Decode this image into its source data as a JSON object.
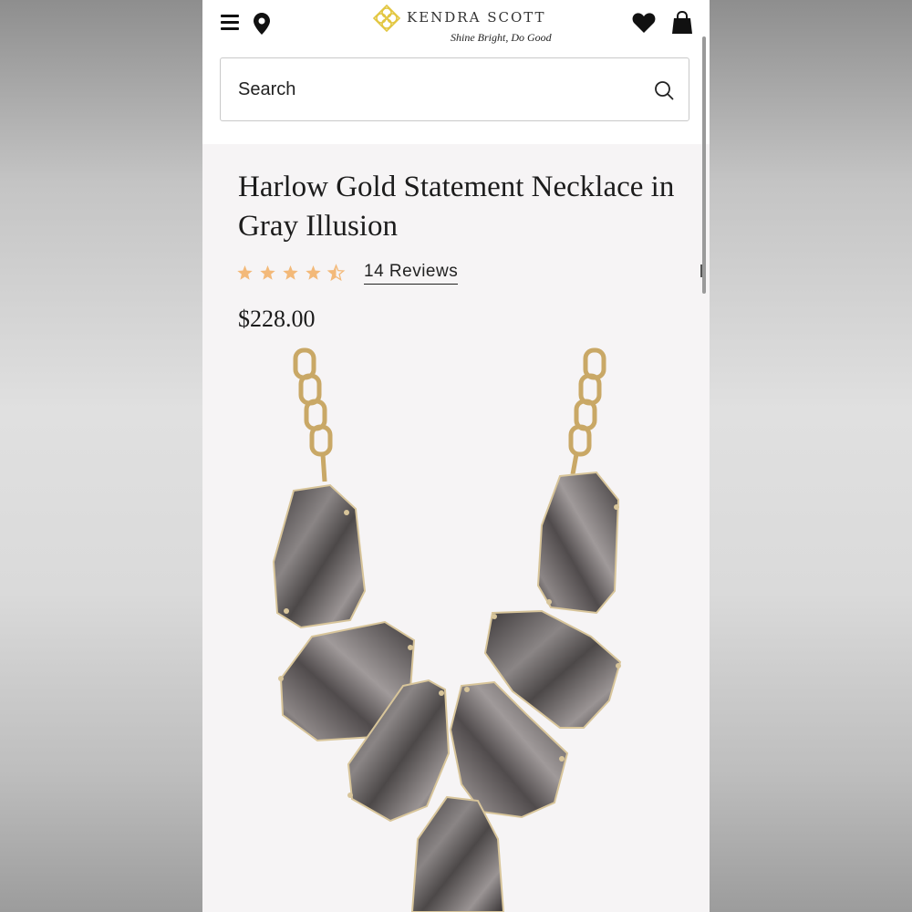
{
  "header": {
    "brand_name": "KENDRA SCOTT",
    "tagline": "Shine Bright, Do Good",
    "icons": [
      "menu-icon",
      "location-pin-icon",
      "logo-icon",
      "heart-icon",
      "shopping-bag-icon"
    ]
  },
  "search": {
    "placeholder": "Search",
    "icon": "search-icon"
  },
  "product": {
    "title": "Harlow Gold Statement Necklace in Gray Illusion",
    "rating": 4.5,
    "rating_max": 5,
    "reviews_label": "14 Reviews",
    "price": "$228.00",
    "image_alt": "necklace-photo"
  },
  "colors": {
    "star": "#f3b979",
    "text": "#1c1c1c",
    "logo_gold": "#e2c640",
    "gold_chain": "#c9a866",
    "stone": "#5a5656"
  }
}
